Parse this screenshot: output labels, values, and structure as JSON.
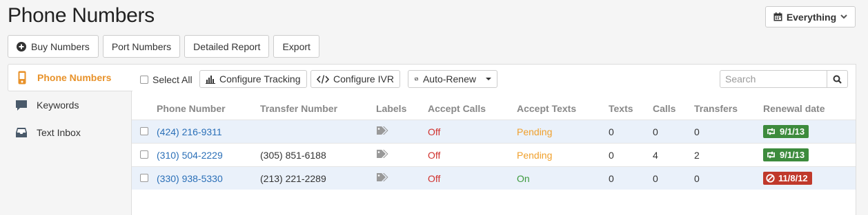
{
  "header": {
    "title": "Phone Numbers",
    "range_label": "Everything"
  },
  "toolbar": {
    "buy": "Buy Numbers",
    "port": "Port Numbers",
    "report": "Detailed Report",
    "export": "Export"
  },
  "sidebar": {
    "items": [
      {
        "label": "Phone Numbers",
        "icon": "phone-icon",
        "active": true
      },
      {
        "label": "Keywords",
        "icon": "speech-bubble-icon",
        "active": false
      },
      {
        "label": "Text Inbox",
        "icon": "inbox-icon",
        "active": false
      }
    ]
  },
  "actions": {
    "select_all": "Select All",
    "configure_tracking": "Configure Tracking",
    "configure_ivr": "Configure IVR",
    "auto_renew": "Auto-Renew",
    "search_placeholder": "Search"
  },
  "table": {
    "columns": [
      "Phone Number",
      "Transfer Number",
      "Labels",
      "Accept Calls",
      "Accept Texts",
      "Texts",
      "Calls",
      "Transfers",
      "Renewal date"
    ],
    "rows": [
      {
        "phone": "(424) 216-9311",
        "transfer": "",
        "accept_calls": "Off",
        "accept_texts": "Pending",
        "texts": "0",
        "calls": "0",
        "transfers": "0",
        "renewal": "9/1/13",
        "renewal_status": "auto-renew"
      },
      {
        "phone": "(310) 504-2229",
        "transfer": "(305) 851-6188",
        "accept_calls": "Off",
        "accept_texts": "Pending",
        "texts": "0",
        "calls": "4",
        "transfers": "2",
        "renewal": "9/1/13",
        "renewal_status": "auto-renew"
      },
      {
        "phone": "(330) 938-5330",
        "transfer": "(213) 221-2289",
        "accept_calls": "Off",
        "accept_texts": "On",
        "texts": "0",
        "calls": "0",
        "transfers": "0",
        "renewal": "11/8/12",
        "renewal_status": "no-renew"
      }
    ]
  },
  "colors": {
    "accent": "#e8922a",
    "link": "#2a6fb7",
    "off": "#d0312d",
    "pending": "#f0a02c",
    "on": "#3c9a3c",
    "badge_green": "#3d8b3d",
    "badge_red": "#c0392b"
  }
}
